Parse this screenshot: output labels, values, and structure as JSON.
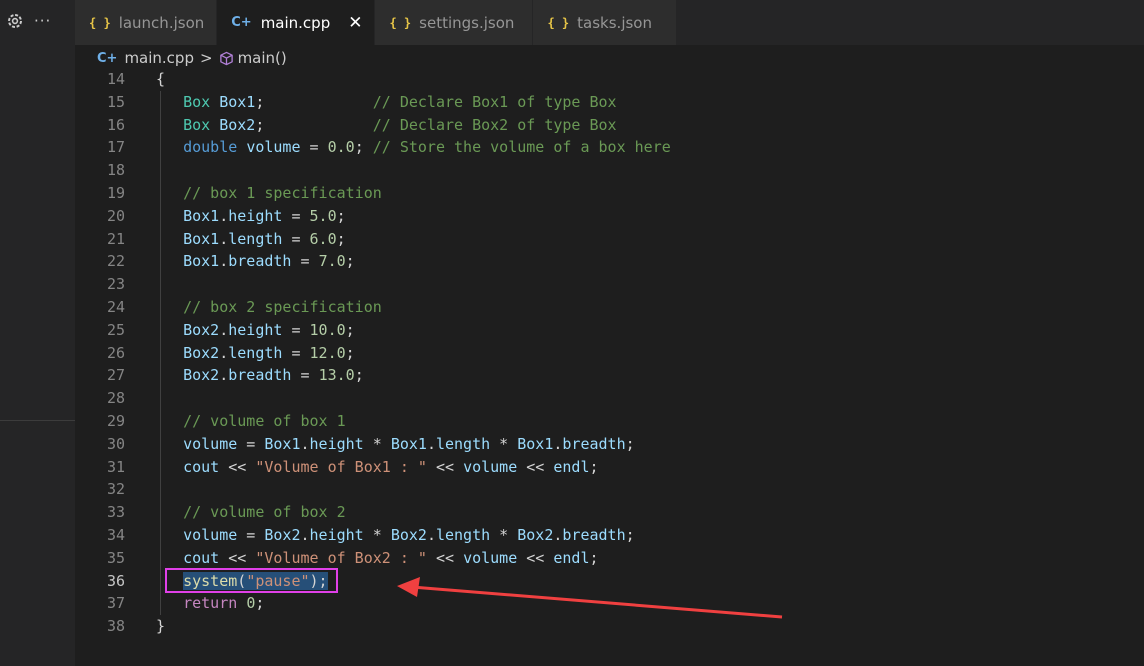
{
  "tabs": [
    {
      "label": "launch.json",
      "icon": "json-braces-icon",
      "active": false
    },
    {
      "label": "main.cpp",
      "icon": "cpp-file-icon",
      "active": true
    },
    {
      "label": "settings.json",
      "icon": "json-braces-icon",
      "active": false
    },
    {
      "label": "tasks.json",
      "icon": "json-braces-icon",
      "active": false
    }
  ],
  "icons": {
    "json": "{ }",
    "cpp": "C+",
    "close": "✕",
    "more": "···",
    "chevron": ">"
  },
  "breadcrumb": {
    "file": "main.cpp",
    "symbol": "main()"
  },
  "editor": {
    "current_line": 36,
    "line_numbers": [
      "14",
      "15",
      "16",
      "17",
      "18",
      "19",
      "20",
      "21",
      "22",
      "23",
      "24",
      "25",
      "26",
      "27",
      "28",
      "29",
      "30",
      "31",
      "32",
      "33",
      "34",
      "35",
      "36",
      "37",
      "38"
    ],
    "lines": [
      [
        [
          "p",
          "{"
        ]
      ],
      [
        [
          "p",
          "   "
        ],
        [
          "type",
          "Box"
        ],
        [
          "p",
          " "
        ],
        [
          "var",
          "Box1"
        ],
        [
          "p",
          ";            "
        ],
        [
          "com",
          "// Declare Box1 of type Box"
        ]
      ],
      [
        [
          "p",
          "   "
        ],
        [
          "type",
          "Box"
        ],
        [
          "p",
          " "
        ],
        [
          "var",
          "Box2"
        ],
        [
          "p",
          ";            "
        ],
        [
          "com",
          "// Declare Box2 of type Box"
        ]
      ],
      [
        [
          "p",
          "   "
        ],
        [
          "kw",
          "double"
        ],
        [
          "p",
          " "
        ],
        [
          "var",
          "volume"
        ],
        [
          "p",
          " = "
        ],
        [
          "num",
          "0.0"
        ],
        [
          "p",
          "; "
        ],
        [
          "com",
          "// Store the volume of a box here"
        ]
      ],
      [
        [
          "p",
          "   "
        ]
      ],
      [
        [
          "p",
          "   "
        ],
        [
          "com",
          "// box 1 specification"
        ]
      ],
      [
        [
          "p",
          "   "
        ],
        [
          "var",
          "Box1"
        ],
        [
          "p",
          "."
        ],
        [
          "var",
          "height"
        ],
        [
          "p",
          " = "
        ],
        [
          "num",
          "5.0"
        ],
        [
          "p",
          ";"
        ]
      ],
      [
        [
          "p",
          "   "
        ],
        [
          "var",
          "Box1"
        ],
        [
          "p",
          "."
        ],
        [
          "var",
          "length"
        ],
        [
          "p",
          " = "
        ],
        [
          "num",
          "6.0"
        ],
        [
          "p",
          ";"
        ]
      ],
      [
        [
          "p",
          "   "
        ],
        [
          "var",
          "Box1"
        ],
        [
          "p",
          "."
        ],
        [
          "var",
          "breadth"
        ],
        [
          "p",
          " = "
        ],
        [
          "num",
          "7.0"
        ],
        [
          "p",
          ";"
        ]
      ],
      [
        [
          "p",
          "   "
        ]
      ],
      [
        [
          "p",
          "   "
        ],
        [
          "com",
          "// box 2 specification"
        ]
      ],
      [
        [
          "p",
          "   "
        ],
        [
          "var",
          "Box2"
        ],
        [
          "p",
          "."
        ],
        [
          "var",
          "height"
        ],
        [
          "p",
          " = "
        ],
        [
          "num",
          "10.0"
        ],
        [
          "p",
          ";"
        ]
      ],
      [
        [
          "p",
          "   "
        ],
        [
          "var",
          "Box2"
        ],
        [
          "p",
          "."
        ],
        [
          "var",
          "length"
        ],
        [
          "p",
          " = "
        ],
        [
          "num",
          "12.0"
        ],
        [
          "p",
          ";"
        ]
      ],
      [
        [
          "p",
          "   "
        ],
        [
          "var",
          "Box2"
        ],
        [
          "p",
          "."
        ],
        [
          "var",
          "breadth"
        ],
        [
          "p",
          " = "
        ],
        [
          "num",
          "13.0"
        ],
        [
          "p",
          ";"
        ]
      ],
      [
        [
          "p",
          "   "
        ]
      ],
      [
        [
          "p",
          "   "
        ],
        [
          "com",
          "// volume of box 1"
        ]
      ],
      [
        [
          "p",
          "   "
        ],
        [
          "var",
          "volume"
        ],
        [
          "p",
          " = "
        ],
        [
          "var",
          "Box1"
        ],
        [
          "p",
          "."
        ],
        [
          "var",
          "height"
        ],
        [
          "p",
          " * "
        ],
        [
          "var",
          "Box1"
        ],
        [
          "p",
          "."
        ],
        [
          "var",
          "length"
        ],
        [
          "p",
          " * "
        ],
        [
          "var",
          "Box1"
        ],
        [
          "p",
          "."
        ],
        [
          "var",
          "breadth"
        ],
        [
          "p",
          ";"
        ]
      ],
      [
        [
          "p",
          "   "
        ],
        [
          "var",
          "cout"
        ],
        [
          "p",
          " << "
        ],
        [
          "str",
          "\"Volume of Box1 : \""
        ],
        [
          "p",
          " << "
        ],
        [
          "var",
          "volume"
        ],
        [
          "p",
          " << "
        ],
        [
          "var",
          "endl"
        ],
        [
          "p",
          ";"
        ]
      ],
      [
        [
          "p",
          "   "
        ]
      ],
      [
        [
          "p",
          "   "
        ],
        [
          "com",
          "// volume of box 2"
        ]
      ],
      [
        [
          "p",
          "   "
        ],
        [
          "var",
          "volume"
        ],
        [
          "p",
          " = "
        ],
        [
          "var",
          "Box2"
        ],
        [
          "p",
          "."
        ],
        [
          "var",
          "height"
        ],
        [
          "p",
          " * "
        ],
        [
          "var",
          "Box2"
        ],
        [
          "p",
          "."
        ],
        [
          "var",
          "length"
        ],
        [
          "p",
          " * "
        ],
        [
          "var",
          "Box2"
        ],
        [
          "p",
          "."
        ],
        [
          "var",
          "breadth"
        ],
        [
          "p",
          ";"
        ]
      ],
      [
        [
          "p",
          "   "
        ],
        [
          "var",
          "cout"
        ],
        [
          "p",
          " << "
        ],
        [
          "str",
          "\"Volume of Box2 : \""
        ],
        [
          "p",
          " << "
        ],
        [
          "var",
          "volume"
        ],
        [
          "p",
          " << "
        ],
        [
          "var",
          "endl"
        ],
        [
          "p",
          ";"
        ]
      ],
      [
        [
          "p",
          "   "
        ],
        [
          "fn",
          "system",
          "sel"
        ],
        [
          "p",
          "(",
          "sel"
        ],
        [
          "str",
          "\"pause\"",
          "sel"
        ],
        [
          "p",
          ");",
          "sel"
        ]
      ],
      [
        [
          "p",
          "   "
        ],
        [
          "ctl",
          "return"
        ],
        [
          "p",
          " "
        ],
        [
          "num",
          "0"
        ],
        [
          "p",
          ";"
        ]
      ],
      [
        [
          "p",
          "}"
        ]
      ]
    ]
  },
  "annotation": {
    "box_color": "#e040e8",
    "arrow_color": "#f04040"
  }
}
